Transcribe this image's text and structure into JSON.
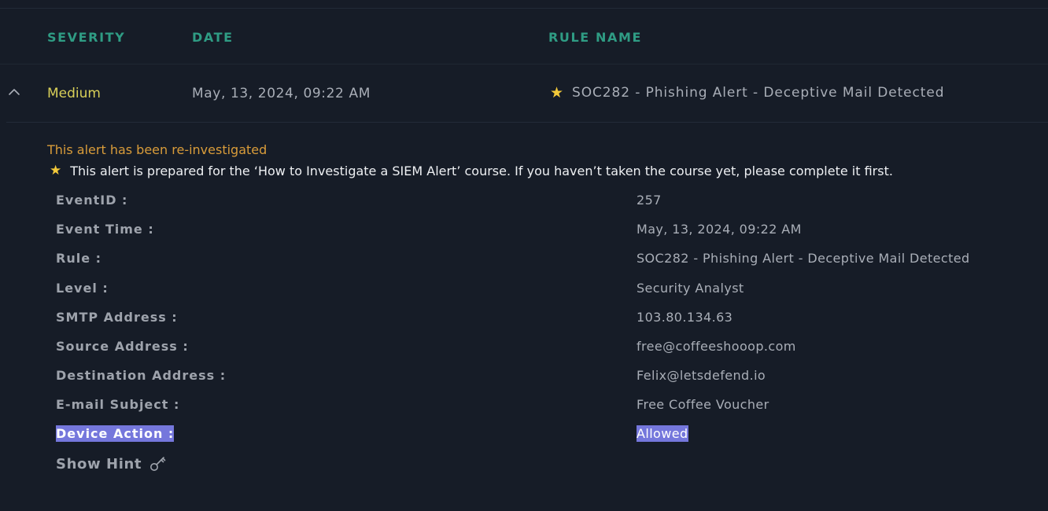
{
  "table_headers": {
    "severity": "SEVERITY",
    "date": "DATE",
    "rule_name": "RULE NAME"
  },
  "alert": {
    "severity": "Medium",
    "date": "May, 13, 2024, 09:22 AM",
    "rule_name": "SOC282 - Phishing Alert - Deceptive Mail Detected",
    "status_note": "This alert has been re-investigated",
    "course_note": "This alert is prepared for the ‘How to Investigate a SIEM Alert’ course. If you haven’t taken the course yet, please complete it first."
  },
  "details": [
    {
      "label": "EventID :",
      "value": "257"
    },
    {
      "label": "Event Time :",
      "value": "May, 13, 2024, 09:22 AM"
    },
    {
      "label": "Rule :",
      "value": "SOC282 - Phishing Alert - Deceptive Mail Detected"
    },
    {
      "label": "Level :",
      "value": "Security Analyst"
    },
    {
      "label": "SMTP Address :",
      "value": "103.80.134.63"
    },
    {
      "label": "Source Address :",
      "value": "free@coffeeshooop.com"
    },
    {
      "label": "Destination Address :",
      "value": "Felix@letsdefend.io"
    },
    {
      "label": "E-mail Subject :",
      "value": "Free Coffee Voucher"
    },
    {
      "label": "Device Action :",
      "value": "Allowed"
    }
  ],
  "show_hint_label": "Show Hint",
  "icons": {
    "collapse": "chevron-up-icon",
    "favorite": "star-icon",
    "hint": "key-icon"
  },
  "colors": {
    "background": "#161c27",
    "header_accent": "#2f9c84",
    "severity_medium": "#d8cf58",
    "reinvestigated": "#d99c3a",
    "star": "#f3c93a",
    "selection": "#7577dc"
  }
}
